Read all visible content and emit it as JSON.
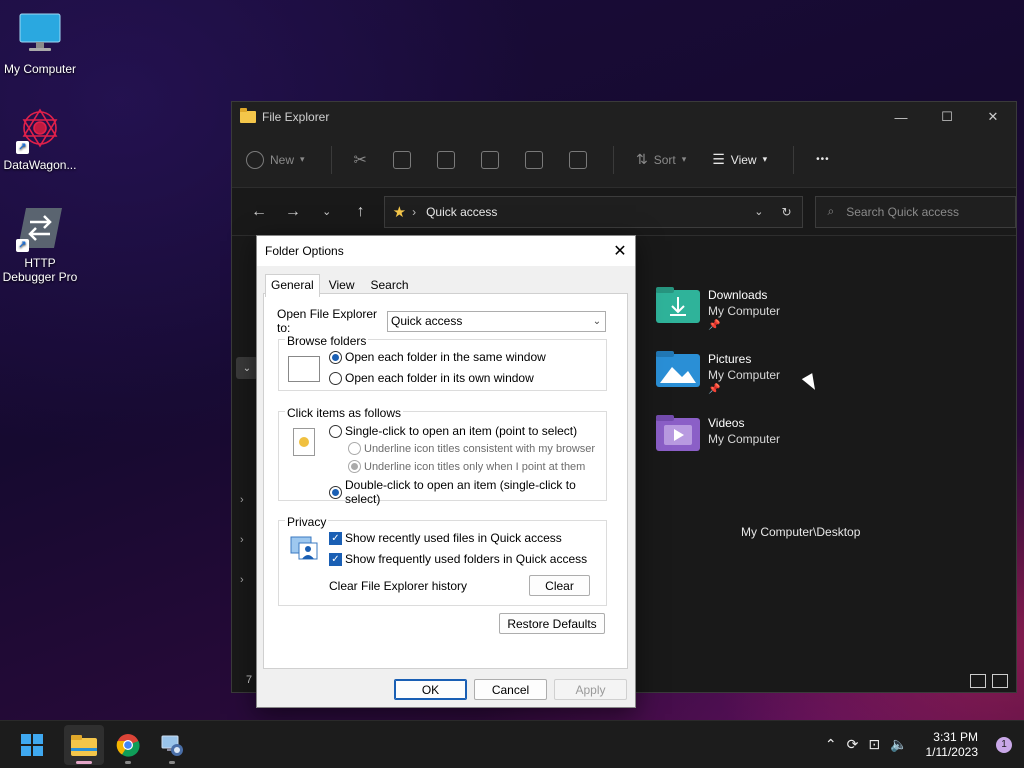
{
  "desktop": {
    "icons": [
      {
        "label": "My Computer"
      },
      {
        "label": "DataWagon..."
      },
      {
        "label": "HTTP Debugger Pro"
      }
    ]
  },
  "explorer": {
    "title": "File Explorer",
    "toolbar": {
      "new_label": "New",
      "sort_label": "Sort",
      "view_label": "View",
      "more_label": "•••"
    },
    "address": {
      "location": "Quick access",
      "separator": "›"
    },
    "search_placeholder": "Search Quick access",
    "items": [
      {
        "name": "Downloads",
        "location": "My Computer",
        "pinned": "📌",
        "color": "#2fb39a"
      },
      {
        "name": "Pictures",
        "location": "My Computer",
        "pinned": "📌",
        "color": "#2a8fd6"
      },
      {
        "name": "Videos",
        "location": "My Computer",
        "pinned": "",
        "color": "#8b5fc7"
      }
    ],
    "recent_path": "My Computer\\Desktop",
    "item_count": "7"
  },
  "dialog": {
    "title": "Folder Options",
    "tabs": [
      "General",
      "View",
      "Search"
    ],
    "open_to_label": "Open File Explorer to:",
    "open_to_value": "Quick access",
    "browse": {
      "label": "Browse folders",
      "same_window": "Open each folder in the same window",
      "own_window": "Open each folder in its own window"
    },
    "click": {
      "label": "Click items as follows",
      "single": "Single-click to open an item (point to select)",
      "underline_browser": "Underline icon titles consistent with my browser",
      "underline_point": "Underline icon titles only when I point at them",
      "double": "Double-click to open an item (single-click to select)"
    },
    "privacy": {
      "label": "Privacy",
      "recent_files": "Show recently used files in Quick access",
      "frequent_folders": "Show frequently used folders in Quick access",
      "clear_history": "Clear File Explorer history",
      "clear_button": "Clear"
    },
    "restore_defaults": "Restore Defaults",
    "ok": "OK",
    "cancel": "Cancel",
    "apply": "Apply"
  },
  "taskbar": {
    "time": "3:31 PM",
    "date": "1/11/2023",
    "notifications": "1"
  }
}
